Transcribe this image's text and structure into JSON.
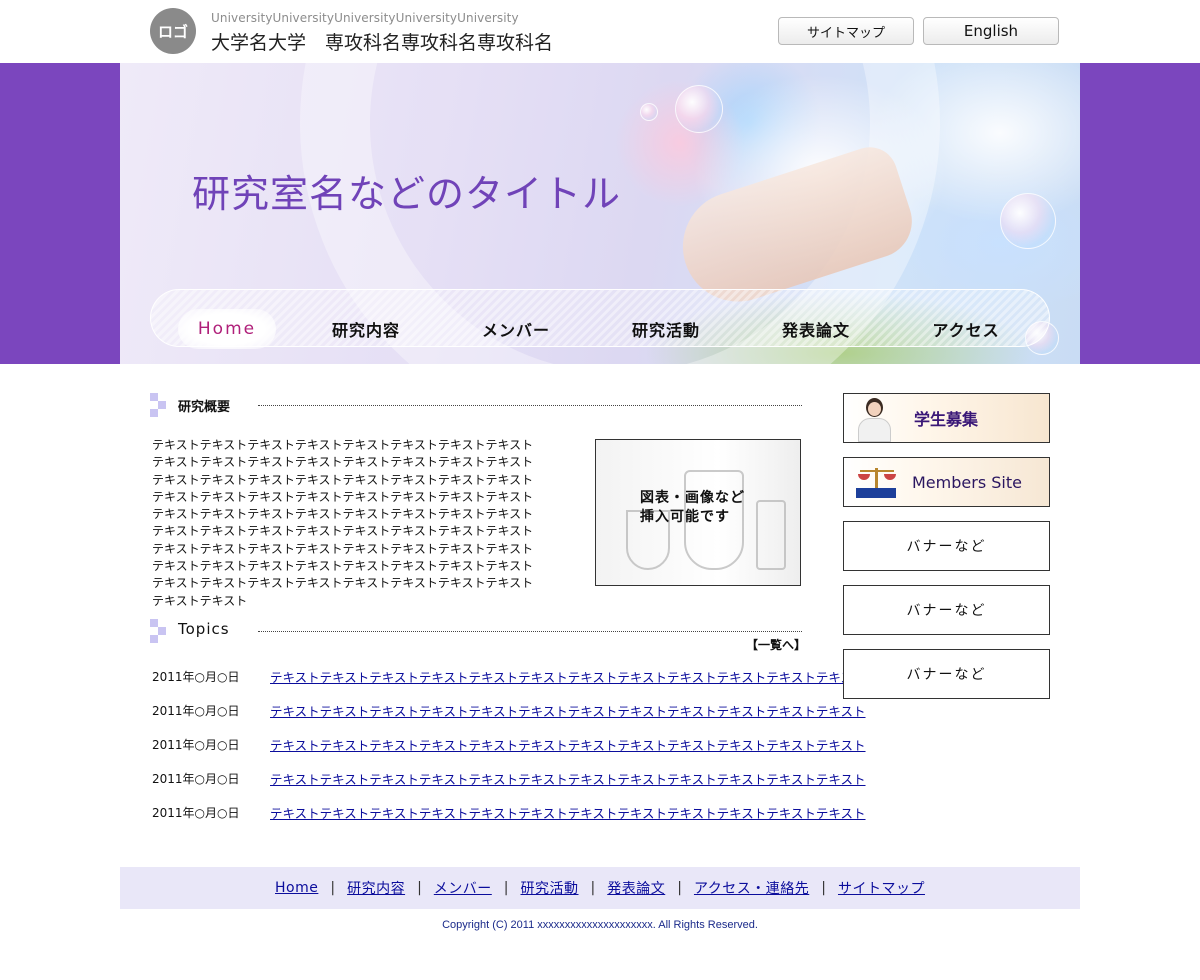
{
  "header": {
    "logo_text": "ロゴ",
    "university_en": "UniversityUniversityUniversityUniversityUniversity",
    "university_ja": "大学名大学　専攻科名専攻科名専攻科名",
    "sitemap_label": "サイトマップ",
    "english_label": "English"
  },
  "hero": {
    "title": "研究室名などのタイトル",
    "nav": [
      "Home",
      "研究内容",
      "メンバー",
      "研究活動",
      "発表論文",
      "アクセス"
    ],
    "active_nav": "Home"
  },
  "overview": {
    "heading": "研究概要",
    "text": "テキストテキストテキストテキストテキストテキストテキストテキストテキストテキストテキストテキストテキストテキストテキストテキストテキストテキストテキストテキストテキストテキストテキストテキストテキストテキストテキストテキストテキストテキストテキストテキストテキストテキストテキストテキストテキストテキストテキストテキストテキストテキストテキストテキストテキストテキストテキストテキストテキストテキストテキストテキストテキストテキストテキストテキストテキストテキストテキストテキストテキストテキストテキストテキストテキストテキストテキストテキストテキストテキストテキストテキストテキストテキスト",
    "figure_caption_line1": "図表・画像など",
    "figure_caption_line2": "挿入可能です"
  },
  "topics": {
    "heading": "Topics",
    "list_all": "【一覧へ】",
    "items": [
      {
        "date": "2011年○月○日",
        "text": "テキストテキストテキストテキストテキストテキストテキストテキストテキストテキストテキストテキスト"
      },
      {
        "date": "2011年○月○日",
        "text": "テキストテキストテキストテキストテキストテキストテキストテキストテキストテキストテキストテキスト"
      },
      {
        "date": "2011年○月○日",
        "text": "テキストテキストテキストテキストテキストテキストテキストテキストテキストテキストテキストテキスト"
      },
      {
        "date": "2011年○月○日",
        "text": "テキストテキストテキストテキストテキストテキストテキストテキストテキストテキストテキストテキスト"
      },
      {
        "date": "2011年○月○日",
        "text": "テキストテキストテキストテキストテキストテキストテキストテキストテキストテキストテキストテキスト"
      }
    ]
  },
  "sidebar": {
    "banners": [
      "学生募集",
      "Members Site",
      "バナーなど",
      "バナーなど",
      "バナーなど"
    ]
  },
  "footer": {
    "links": [
      "Home",
      "研究内容",
      "メンバー",
      "研究活動",
      "発表論文",
      "アクセス・連絡先",
      "サイトマップ"
    ],
    "separator": "|",
    "copyright": "Copyright (C) 2011 xxxxxxxxxxxxxxxxxxxxx. All Rights Reserved."
  },
  "colors": {
    "brand_purple": "#7b46be",
    "title_purple": "#7043b8",
    "link_blue": "#0b0d9c",
    "footer_bg": "#e9e7f8",
    "accent_square": "#c9c4f2"
  }
}
